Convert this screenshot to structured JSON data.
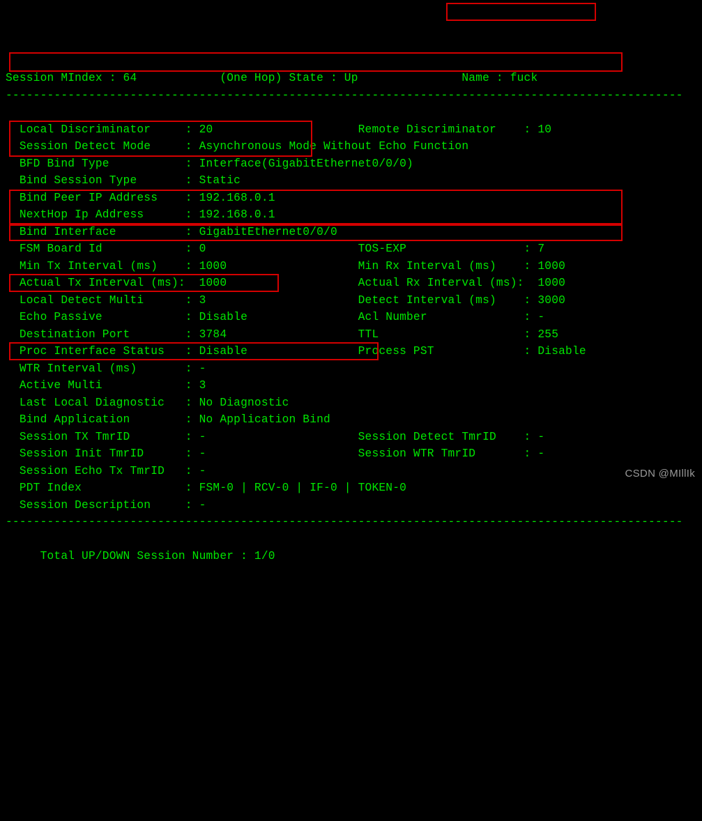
{
  "header": {
    "session_mindex_label": "Session MIndex",
    "session_mindex_value": "64",
    "hop_state": "(One Hop) State : Up",
    "name_label": "Name",
    "name_value": "fuck"
  },
  "rows": [
    {
      "k": "Local Discriminator",
      "v": "20",
      "k2": "Remote Discriminator",
      "v2": "10"
    },
    {
      "k": "Session Detect Mode",
      "v": "Asynchronous Mode Without Echo Function"
    },
    {
      "k": "BFD Bind Type",
      "v": "Interface(GigabitEthernet0/0/0)"
    },
    {
      "k": "Bind Session Type",
      "v": "Static"
    },
    {
      "k": "Bind Peer IP Address",
      "v": "192.168.0.1"
    },
    {
      "k": "NextHop Ip Address",
      "v": "192.168.0.1"
    },
    {
      "k": "Bind Interface",
      "v": "GigabitEthernet0/0/0"
    },
    {
      "k": "FSM Board Id",
      "v": "0",
      "k2": "TOS-EXP",
      "v2": "7"
    },
    {
      "k": "Min Tx Interval (ms)",
      "v": "1000",
      "k2": "Min Rx Interval (ms)",
      "v2": "1000"
    },
    {
      "k": "Actual Tx Interval (ms)",
      "v": "1000",
      "colon_tight": true,
      "k2": "Actual Rx Interval (ms)",
      "v2": "1000",
      "colon2_tight": true
    },
    {
      "k": "Local Detect Multi",
      "v": "3",
      "k2": "Detect Interval (ms)",
      "v2": "3000"
    },
    {
      "k": "Echo Passive",
      "v": "Disable",
      "k2": "Acl Number",
      "v2": "-"
    },
    {
      "k": "Destination Port",
      "v": "3784",
      "k2": "TTL",
      "v2": "255"
    },
    {
      "k": "Proc Interface Status",
      "v": "Disable",
      "k2": "Process PST",
      "v2": "Disable"
    },
    {
      "k": "WTR Interval (ms)",
      "v": "-"
    },
    {
      "k": "Active Multi",
      "v": "3"
    },
    {
      "k": "Last Local Diagnostic",
      "v": "No Diagnostic"
    },
    {
      "k": "Bind Application",
      "v": "No Application Bind"
    },
    {
      "k": "Session TX TmrID",
      "v": "-",
      "k2": "Session Detect TmrID",
      "v2": "-"
    },
    {
      "k": "Session Init TmrID",
      "v": "-",
      "k2": "Session WTR TmrID",
      "v2": "-"
    },
    {
      "k": "Session Echo Tx TmrID",
      "v": "-"
    },
    {
      "k": "PDT Index",
      "v": "FSM-0 | RCV-0 | IF-0 | TOKEN-0"
    },
    {
      "k": "Session Description",
      "v": "-"
    }
  ],
  "footer": {
    "total_label": "Total UP/DOWN Session Number",
    "total_value": "1/0"
  },
  "dash_line": "--------------------------------------------------------------------------------------------------",
  "watermark": "CSDN @MIllIk"
}
